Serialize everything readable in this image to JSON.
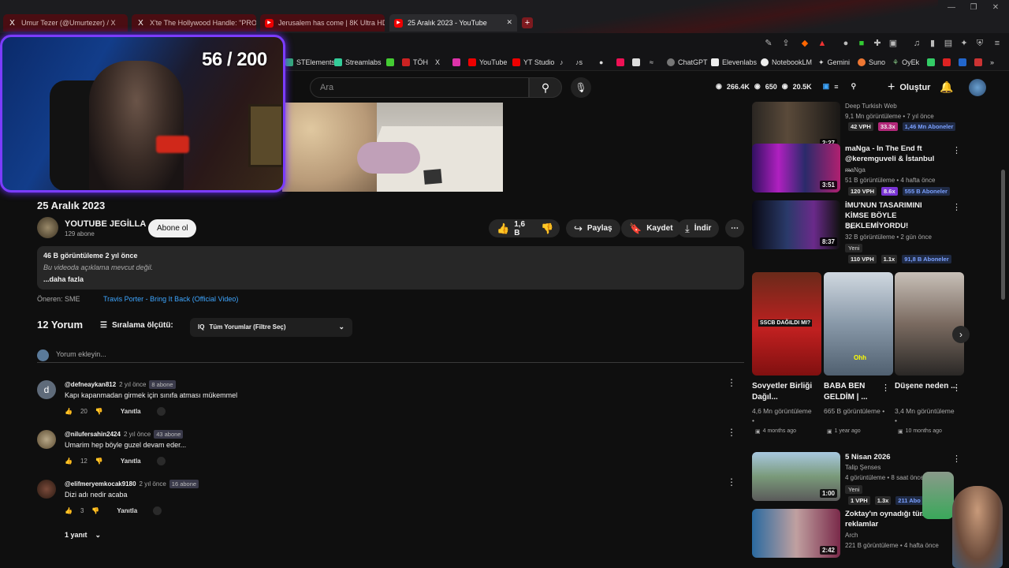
{
  "tabs": [
    {
      "label": "Umur Tezer (@Umurtezer) / X",
      "icon": "x-logo-icon"
    },
    {
      "label": "X'te The Hollywood Handle: \"PROJE",
      "icon": "x-logo-icon"
    },
    {
      "label": "Jerusalem has come | 8K Ultra HD Ci",
      "icon": "youtube-icon"
    },
    {
      "label": "25 Aralık 2023 - YouTube",
      "icon": "youtube-icon"
    }
  ],
  "bookmarks": [
    "STElements",
    "Streamlabs",
    "TÖH",
    "YouTube",
    "YT Studio",
    "ChatGPT",
    "Elevenlabs",
    "NotebookLM",
    "Gemini",
    "Suno",
    "OyEk"
  ],
  "stream_counter": "56 / 200",
  "search": {
    "placeholder": "Ara"
  },
  "header_stats": {
    "views": "266.4K",
    "likes": "650",
    "subs": "20.5K"
  },
  "create_label": "Oluştur",
  "video": {
    "title": "25 Aralık 2023",
    "channel": "YOUTUBE JEGİLLA",
    "subscribers": "129 abone",
    "subscribe_label": "Abone ol",
    "likes": "1,6 B",
    "share": "Paylaş",
    "save": "Kaydet",
    "download": "İndir",
    "description": {
      "stats": "46 B görüntüleme  2 yıl önce",
      "text": "Bu videoda açıklama mevcut değil.",
      "more": "...daha fazla"
    },
    "recommended_by": "Öneren: SME",
    "recommended_link": "Travis Porter - Bring It Back (Official Video)"
  },
  "comments": {
    "count": "12 Yorum",
    "sort_label": "Sıralama ölçütü:",
    "filter": "Tüm Yorumlar (Filtre Seç)",
    "add_placeholder": "Yorum ekleyin...",
    "items": [
      {
        "user": "@defneaykan812",
        "time": "2 yıl önce",
        "badge": "8 abone",
        "text": "Kapı kapanmadan girmek için sınıfa atması mükemmel",
        "likes": "20",
        "reply": "Yanıtla",
        "avatar": "d",
        "avatar_color": "#5f6b7a"
      },
      {
        "user": "@nilufersahin2424",
        "time": "2 yıl önce",
        "badge": "43 abone",
        "text": "Umarim hep böyle guzel devam eder...",
        "likes": "12",
        "reply": "Yanıtla",
        "avatar": "",
        "avatar_color": "#8a7a5a"
      },
      {
        "user": "@elifmeryemkocak9180",
        "time": "2 yıl önce",
        "badge": "16 abone",
        "text": "Dizi adı nedir acaba",
        "likes": "3",
        "reply": "Yanıtla",
        "avatar": "",
        "avatar_color": "#5a3a2a"
      }
    ],
    "replies_label": "1 yanıt"
  },
  "sidebar": [
    {
      "title": "",
      "channel": "Deep Turkish Web",
      "meta": "9,1 Mn görüntüleme • 7 yıl önce",
      "duration": "2:27",
      "tags": [
        "42 VPH",
        "33.3x",
        "1,46 Mn Aboneler"
      ]
    },
    {
      "title": "maNga - In The End ft @keremguveli & İstanbul ...",
      "channel": "maNga",
      "meta": "51 B görüntüleme • 4 hafta önce",
      "duration": "3:51",
      "tags": [
        "120 VPH",
        "8.6x",
        "555 B Aboneler"
      ]
    },
    {
      "title": "İMU'NUN TASARIMINI KİMSE BÖYLE BEKLEMİYORDU!",
      "channel": "GLY",
      "meta": "32 B görüntüleme • 2 gün önce",
      "new": "Yeni",
      "duration": "8:37",
      "tags": [
        "110 VPH",
        "1.1x",
        "91,8 B Aboneler"
      ]
    },
    {
      "title": "5 Nisan 2026",
      "channel": "Talip Şenses",
      "meta": "4 görüntüleme • 8 saat önce",
      "new": "Yeni",
      "duration": "1:00",
      "tags": [
        "1 VPH",
        "1.3x",
        "211 Abo"
      ]
    },
    {
      "title": "Zoktay'ın oynadığı tüm reklamlar",
      "channel": "Arch",
      "meta": "221 B görüntüleme • 4 hafta önce",
      "duration": "2:42",
      "tags": []
    }
  ],
  "shorts": [
    {
      "title": "Sovyetler Birliği Dağıl...",
      "views": "4,6 Mn görüntüleme •",
      "ago": "4 months ago",
      "overlay": "SSCB DAĞILDI MI?"
    },
    {
      "title": "BABA BEN GELDİM | ...",
      "views": "665 B görüntüleme •",
      "ago": "1 year ago",
      "overlay": "Ohh"
    },
    {
      "title": "Düşene neden ...",
      "views": "3,4 Mn görüntüleme •",
      "ago": "10 months ago",
      "overlay": ""
    }
  ]
}
